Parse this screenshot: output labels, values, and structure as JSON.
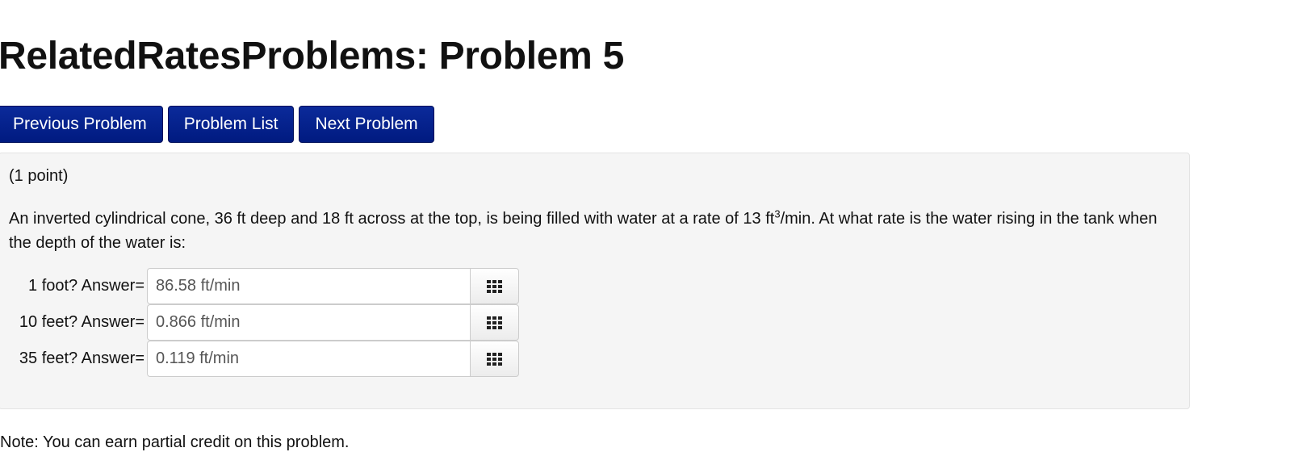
{
  "page": {
    "title": "RelatedRatesProblems: Problem 5"
  },
  "nav": {
    "previous_label": "Previous Problem",
    "list_label": "Problem List",
    "next_label": "Next Problem"
  },
  "problem": {
    "points": "(1 point)",
    "statement_part1": "An inverted cylindrical cone, 36 ft deep and 18 ft across at the top, is being filled with water at a rate of 13 ft",
    "statement_sup": "3",
    "statement_part2": "/min. At what rate is the water rising in the tank when the depth of the water is:",
    "answers": [
      {
        "label": "1 foot? Answer=",
        "value": "86.58 ft/min",
        "icon": "grid-icon"
      },
      {
        "label": "10 feet? Answer=",
        "value": "0.866 ft/min",
        "icon": "grid-icon"
      },
      {
        "label": "35 feet? Answer=",
        "value": "0.119 ft/min",
        "icon": "grid-icon"
      }
    ]
  },
  "footer": {
    "note": "Note: You can earn partial credit on this problem."
  }
}
